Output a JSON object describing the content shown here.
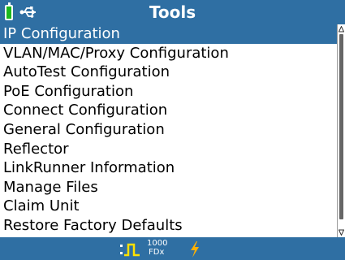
{
  "header": {
    "title": "Tools"
  },
  "menu": {
    "items": [
      {
        "label": "IP Configuration"
      },
      {
        "label": "VLAN/MAC/Proxy Configuration"
      },
      {
        "label": "AutoTest Configuration"
      },
      {
        "label": "PoE Configuration"
      },
      {
        "label": "Connect Configuration"
      },
      {
        "label": "General Configuration"
      },
      {
        "label": "Reflector"
      },
      {
        "label": "LinkRunner Information"
      },
      {
        "label": "Manage Files"
      },
      {
        "label": "Claim Unit"
      },
      {
        "label": "Restore Factory Defaults"
      }
    ],
    "selected_index": 0
  },
  "status": {
    "speed": "1000",
    "duplex": "FDx"
  },
  "colors": {
    "bar": "#2f6fa3",
    "battery": "#1db91d",
    "link": "#ffe100",
    "bolt": "#ffb000"
  },
  "icons": [
    "battery-icon",
    "usb-icon",
    "link-pulse-icon",
    "power-bolt-icon"
  ]
}
